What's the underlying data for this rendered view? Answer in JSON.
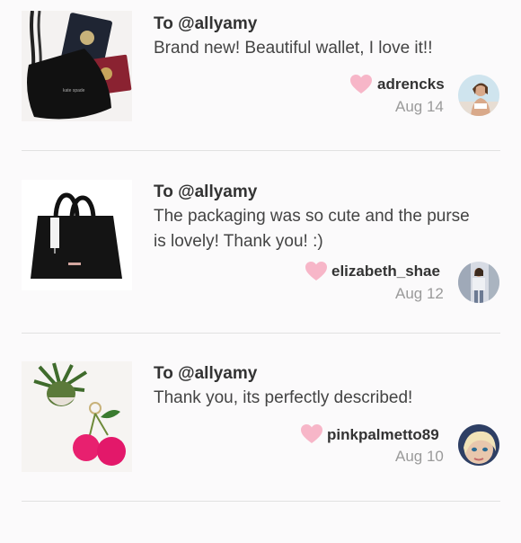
{
  "reviews": [
    {
      "to": "To @allyamy",
      "message": "Brand new! Beautiful wallet, I love it!!",
      "username": "adrencks",
      "date": "Aug 14",
      "thumb_icon": "wallet-passport-photo",
      "avatar_icon": "user-avatar-photo"
    },
    {
      "to": "To @allyamy",
      "message": "The packaging was so cute and the purse is lovely! Thank you! :)",
      "username": "elizabeth_shae",
      "date": "Aug 12",
      "thumb_icon": "black-handbag-photo",
      "avatar_icon": "user-avatar-photo"
    },
    {
      "to": "To @allyamy",
      "message": "Thank you, its perfectly described!",
      "username": "pinkpalmetto89",
      "date": "Aug 10",
      "thumb_icon": "pom-pom-keychain-photo",
      "avatar_icon": "user-avatar-photo"
    }
  ],
  "colors": {
    "heart": "#f7b6c8",
    "divider": "#e1e1e1",
    "date": "#9a9a9a"
  }
}
